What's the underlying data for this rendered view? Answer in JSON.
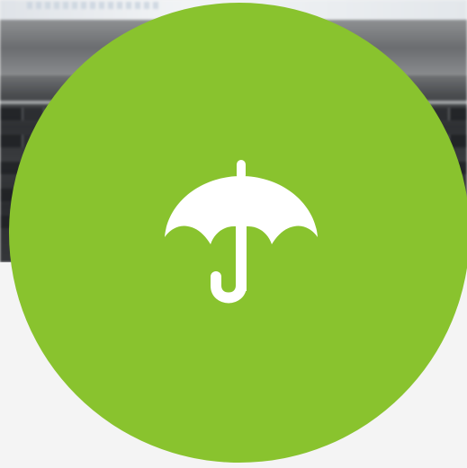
{
  "background": {
    "description_icon": "laptop-keyboard-photo"
  },
  "badge": {
    "color": "#89c32e",
    "icon": "umbrella-icon",
    "icon_color": "#ffffff"
  }
}
